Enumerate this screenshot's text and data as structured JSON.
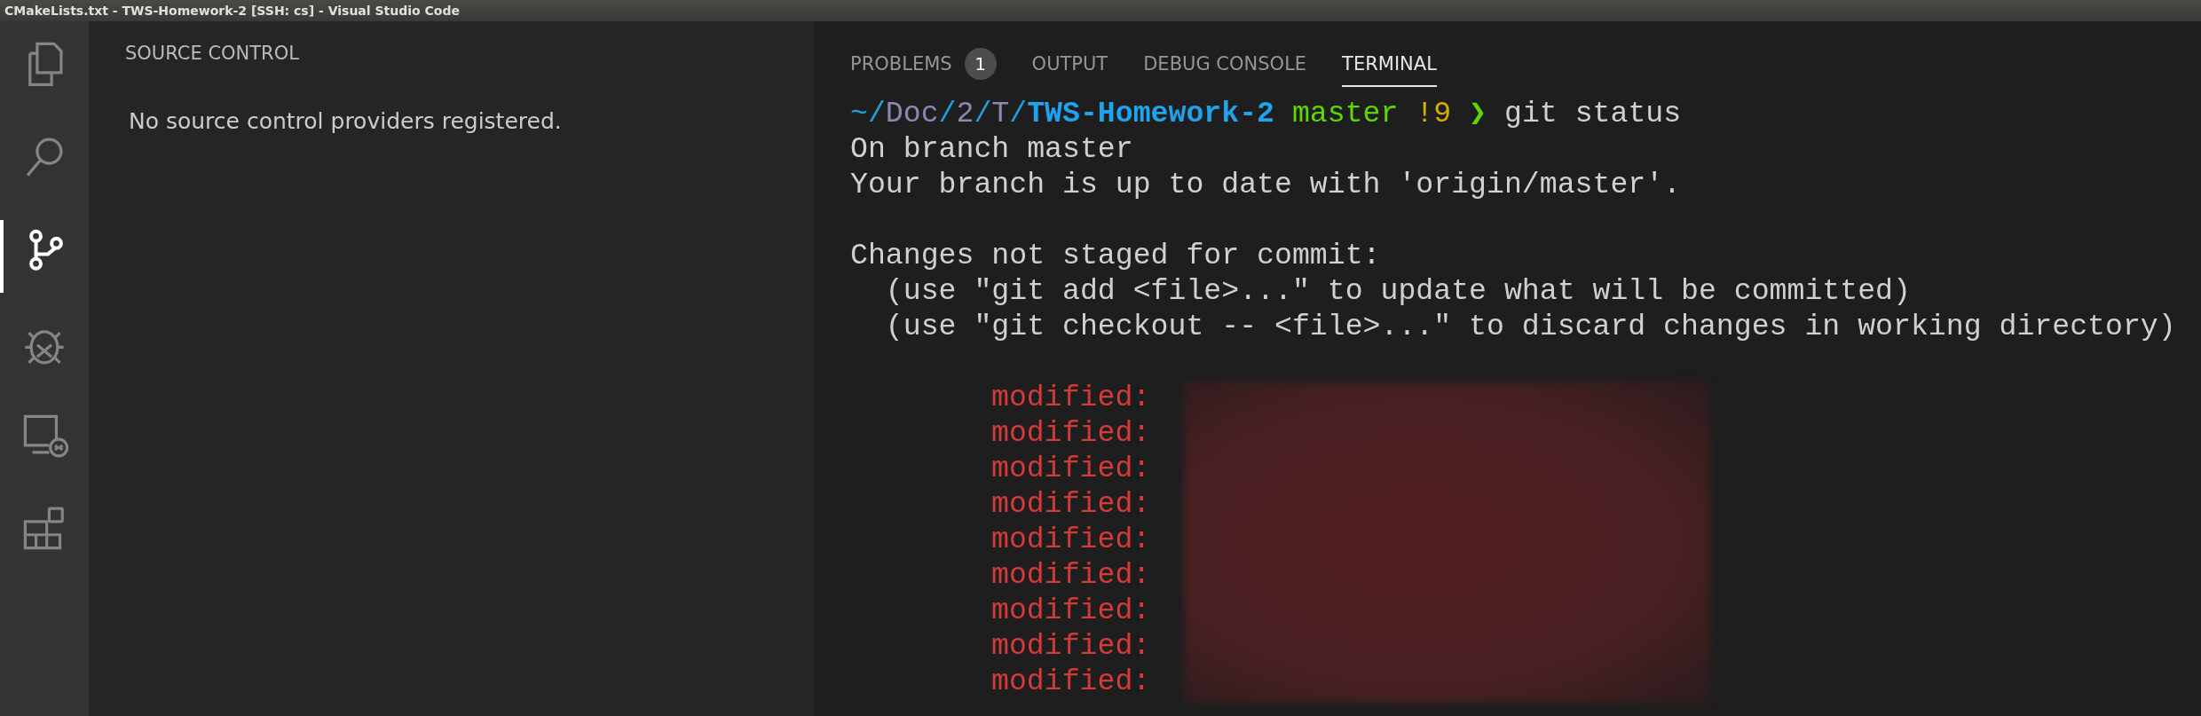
{
  "window": {
    "title": "CMakeLists.txt - TWS-Homework-2 [SSH: cs] - Visual Studio Code"
  },
  "activity_bar": [
    {
      "kind": "files",
      "selected": false
    },
    {
      "kind": "search",
      "selected": false
    },
    {
      "kind": "source-control",
      "selected": true
    },
    {
      "kind": "debug",
      "selected": false
    },
    {
      "kind": "remote",
      "selected": false
    },
    {
      "kind": "extensions",
      "selected": false
    }
  ],
  "sidebar": {
    "title": "SOURCE CONTROL",
    "message": "No source control providers registered."
  },
  "panel": {
    "tabs": [
      {
        "label": "PROBLEMS",
        "badge": "1",
        "selected": false
      },
      {
        "label": "OUTPUT",
        "selected": false
      },
      {
        "label": "DEBUG CONSOLE",
        "selected": false
      },
      {
        "label": "TERMINAL",
        "selected": true
      }
    ],
    "terminal": {
      "lines": [
        {
          "kind": "prompt",
          "segments": [
            {
              "text": "~/",
              "color": "#1ea0d8"
            },
            {
              "text": "Doc",
              "color": "#8c87b3"
            },
            {
              "text": "/",
              "color": "#1ea0d8"
            },
            {
              "text": "2",
              "color": "#8c87b3"
            },
            {
              "text": "/",
              "color": "#1ea0d8"
            },
            {
              "text": "T",
              "color": "#8c87b3"
            },
            {
              "text": "/",
              "color": "#1ea0d8"
            },
            {
              "text": "TWS-Homework-2",
              "color": "#1fa3ec",
              "bold": true
            },
            {
              "text": " master",
              "color": "#5fd700"
            },
            {
              "text": " !9",
              "color": "#d7af00"
            },
            {
              "text": " ❯",
              "color": "#5fd700",
              "bold": true
            },
            {
              "text": " git status",
              "color": "#d0d0d0"
            }
          ]
        },
        {
          "kind": "output",
          "text": "On branch master"
        },
        {
          "kind": "output",
          "text": "Your branch is up to date with 'origin/master'."
        },
        {
          "kind": "output",
          "text": "Changes not staged for commit:",
          "blank_before": true
        },
        {
          "kind": "output",
          "text": "  (use \"git add <file>...\" to update what will be committed)"
        },
        {
          "kind": "output",
          "text": "  (use \"git checkout -- <file>...\" to discard changes in working directory)"
        },
        {
          "kind": "modified",
          "blank_before": true,
          "items": [
            "modified:",
            "modified:",
            "modified:",
            "modified:",
            "modified:",
            "modified:",
            "modified:",
            "modified:",
            "modified:"
          ]
        }
      ]
    }
  }
}
